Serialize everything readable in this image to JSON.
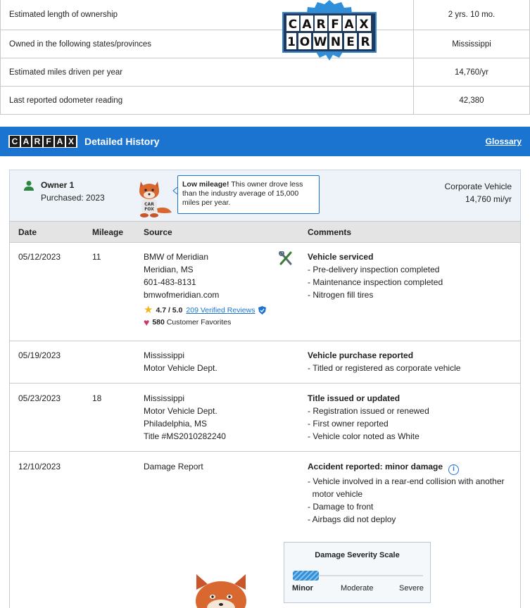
{
  "summary": {
    "rows": [
      {
        "label": "Estimated length of ownership",
        "value": "2 yrs. 10 mo."
      },
      {
        "label": "Owned in the following states/provinces",
        "value": "Mississippi"
      },
      {
        "label": "Estimated miles driven per year",
        "value": "14,760/yr"
      },
      {
        "label": "Last reported odometer reading",
        "value": "42,380"
      }
    ],
    "badge": {
      "brand": "CARFAX",
      "line2": "1 OWNER"
    }
  },
  "header": {
    "logo_letters": [
      "C",
      "A",
      "R",
      "F",
      "A",
      "X"
    ],
    "title": "Detailed History",
    "glossary_link": "Glossary",
    "background": "#1b75d0"
  },
  "owner": {
    "name": "Owner 1",
    "purchased": "Purchased: 2023",
    "tip_bold": "Low mileage!",
    "tip_text": " This owner drove less than the industry average of 15,000 miles per year.",
    "type": "Corporate Vehicle",
    "miles_per_year": "14,760 mi/yr",
    "icon": "person-icon"
  },
  "table": {
    "headers": {
      "date": "Date",
      "mileage": "Mileage",
      "source": "Source",
      "comments": "Comments"
    },
    "records": [
      {
        "date": "05/12/2023",
        "mileage": "11",
        "source": [
          "BMW of Meridian",
          "Meridian, MS",
          "601-483-8131",
          "bmwofmeridian.com"
        ],
        "rating": "4.7 / 5.0",
        "reviews_link": "209 Verified Reviews",
        "favorites_count": "580",
        "favorites_label": "Customer Favorites",
        "comment_title": "Vehicle serviced",
        "comments": [
          "- Pre-delivery inspection completed",
          "- Maintenance inspection completed",
          "- Nitrogen fill tires"
        ]
      },
      {
        "date": "05/19/2023",
        "mileage": "",
        "source": [
          "Mississippi",
          "Motor Vehicle Dept."
        ],
        "comment_title": "Vehicle purchase reported",
        "comments": [
          "- Titled or registered as corporate vehicle"
        ]
      },
      {
        "date": "05/23/2023",
        "mileage": "18",
        "source": [
          "Mississippi",
          "Motor Vehicle Dept.",
          "Philadelphia, MS",
          "Title #MS2010282240"
        ],
        "comment_title": "Title issued or updated",
        "comments": [
          "- Registration issued or renewed",
          "- First owner reported",
          "- Vehicle color noted as White"
        ]
      },
      {
        "date": "12/10/2023",
        "mileage": "",
        "source": [
          "Damage Report"
        ],
        "comment_title": "Accident reported: minor damage",
        "comments": [
          "- Vehicle involved in a rear-end collision with another",
          "  motor vehicle",
          "- Damage to front",
          "- Airbags did not deploy"
        ]
      }
    ]
  },
  "damage_scale": {
    "title": "Damage Severity Scale",
    "labels": [
      "Minor",
      "Moderate",
      "Severe"
    ],
    "level": 0.2
  }
}
